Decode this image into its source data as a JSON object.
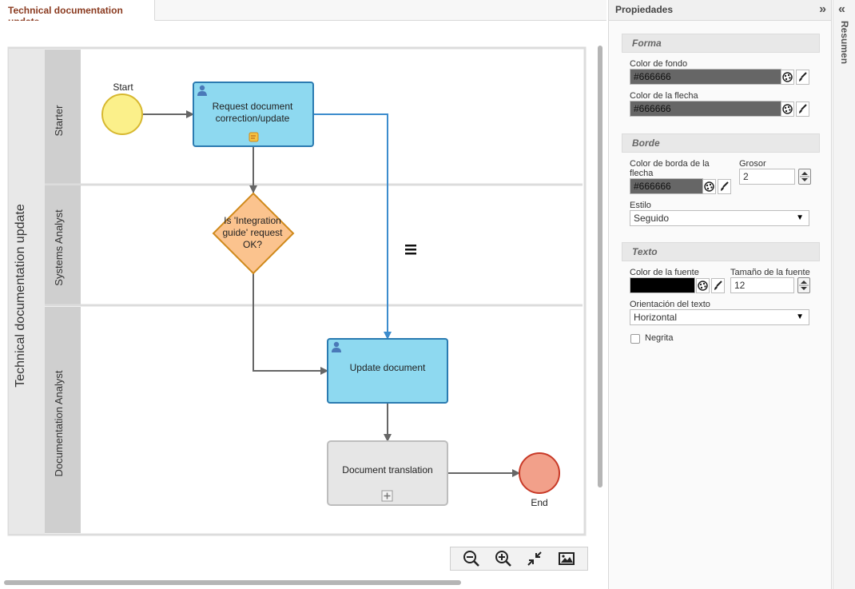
{
  "editor": {
    "tab_label": "Technical documentation update"
  },
  "diagram": {
    "pool_title": "Technical documentation update",
    "lanes": [
      {
        "label": "Starter"
      },
      {
        "label": "Systems Analyst"
      },
      {
        "label": "Documentation Analyst"
      }
    ],
    "start_label": "Start",
    "end_label": "End",
    "task_request_line1": "Request document",
    "task_request_line2": "correction/update",
    "gateway_line1": "Is 'Integration",
    "gateway_line2": "guide' request",
    "gateway_line3": "OK?",
    "task_update": "Update document",
    "subprocess_translation": "Document translation",
    "colors": {
      "start_fill": "#fbf08a",
      "task_fill": "#8ed9f0",
      "gateway_fill": "#fbc38e",
      "end_fill": "#f2a08a",
      "subprocess_fill": "#e6e6e6",
      "selected_flow": "#3c8ccd"
    }
  },
  "zoom_toolbar": {
    "icons": [
      "zoom-out-icon",
      "zoom-in-icon",
      "fit-icon",
      "image-export-icon"
    ]
  },
  "properties": {
    "title": "Propiedades",
    "collapse_icon": "»",
    "forma": {
      "title": "Forma",
      "fondo_label": "Color de fondo",
      "fondo_value": "#666666",
      "flecha_label": "Color de la flecha",
      "flecha_value": "#666666"
    },
    "borde": {
      "title": "Borde",
      "borde_color_label": "Color de borda de la flecha",
      "borde_color_value": "#666666",
      "grosor_label": "Grosor",
      "grosor_value": "2",
      "estilo_label": "Estilo",
      "estilo_value": "Seguido"
    },
    "texto": {
      "title": "Texto",
      "fuente_color_label": "Color de la fuente",
      "fuente_color_value": "#000000",
      "tamano_label": "Tamaño de la fuente",
      "tamano_value": "12",
      "orientacion_label": "Orientación del texto",
      "orientacion_value": "Horizontal",
      "negrita_label": "Negrita",
      "negrita_checked": false
    }
  },
  "summary": {
    "label": "Resumen",
    "expand_icon": "«"
  }
}
